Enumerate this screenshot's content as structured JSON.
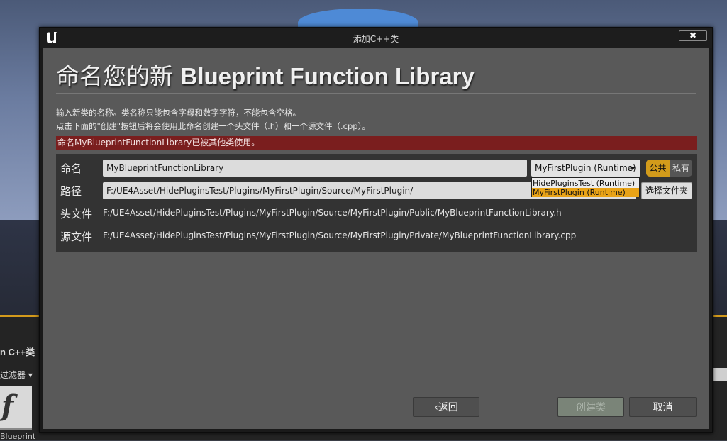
{
  "dialog": {
    "title": "添加C++类",
    "close_label": "✖",
    "heading_prefix": "命名您的新",
    "heading_class": "Blueprint Function Library",
    "description_line1": "输入新类的名称。类名称只能包含字母和数字字符，不能包含空格。",
    "description_line2": "点击下面的\"创建\"按钮后将会使用此命名创建一个头文件（.h）和一个源文件（.cpp）。",
    "error_message": "命名MyBlueprintFunctionLibrary已被其他类使用。"
  },
  "form": {
    "name_label": "命名",
    "name_value": "MyBlueprintFunctionLibrary",
    "module_selected": "MyFirstPlugin (Runtime)",
    "module_options": [
      "HidePluginsTest (Runtime)",
      "MyFirstPlugin (Runtime)"
    ],
    "visibility_public": "公共",
    "visibility_private": "私有",
    "path_label": "路径",
    "path_value": "F:/UE4Asset/HidePluginsTest/Plugins/MyFirstPlugin/Source/MyFirstPlugin/",
    "browse_label": "选择文件夹",
    "header_label": "头文件",
    "header_value": "F:/UE4Asset/HidePluginsTest/Plugins/MyFirstPlugin/Source/MyFirstPlugin/Public/MyBlueprintFunctionLibrary.h",
    "source_label": "源文件",
    "source_value": "F:/UE4Asset/HidePluginsTest/Plugins/MyFirstPlugin/Source/MyFirstPlugin/Private/MyBlueprintFunctionLibrary.cpp"
  },
  "buttons": {
    "back": "返回",
    "create": "创建类",
    "cancel": "取消"
  },
  "background": {
    "panel_title": "n C++类",
    "filter_label": "过滤器",
    "thumb_glyph": "f",
    "thumb_label": "Blueprint"
  },
  "colors": {
    "accent": "#d29b1b",
    "error_bg": "#7a1e1e",
    "dropdown_selected": "#e9a317"
  }
}
